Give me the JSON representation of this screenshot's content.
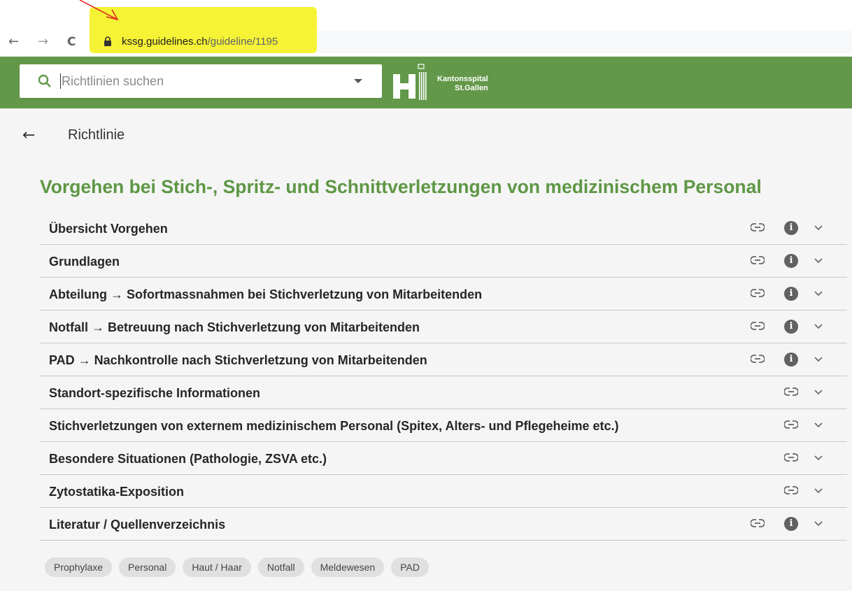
{
  "browser": {
    "back": "←",
    "forward": "→",
    "reload": "C",
    "url_host": "kssg.guidelines.ch",
    "url_path": "/guideline/1195"
  },
  "header": {
    "search_placeholder": "Richtlinien suchen",
    "logo_line1": "Kantonsspital",
    "logo_line2": "St.Gallen",
    "brand_color": "#63984a"
  },
  "page": {
    "back": "←",
    "title": "Richtlinie",
    "guideline_title": "Vorgehen bei Stich-, Spritz- und Schnittverletzungen von medizinischem Personal"
  },
  "sections": [
    {
      "label": "Übersicht Vorgehen",
      "has_info": true
    },
    {
      "label": "Grundlagen",
      "has_info": true
    },
    {
      "label": "Abteilung → Sofortmassnahmen bei Stichverletzung von Mitarbeitenden",
      "has_info": true
    },
    {
      "label": "Notfall → Betreuung nach Stichverletzung von Mitarbeitenden",
      "has_info": true
    },
    {
      "label": "PAD → Nachkontrolle nach Stichverletzung von Mitarbeitenden",
      "has_info": true
    },
    {
      "label": "Standort-spezifische Informationen",
      "has_info": false
    },
    {
      "label": "Stichverletzungen von externem medizinischem Personal (Spitex, Alters- und Pflegeheime etc.)",
      "has_info": false
    },
    {
      "label": "Besondere Situationen (Pathologie, ZSVA etc.)",
      "has_info": false
    },
    {
      "label": "Zytostatika-Exposition",
      "has_info": false
    },
    {
      "label": "Literatur / Quellenverzeichnis",
      "has_info": true
    }
  ],
  "tags": [
    "Prophylaxe",
    "Personal",
    "Haut / Haar",
    "Notfall",
    "Meldewesen",
    "PAD"
  ],
  "icons": {
    "link": "link-icon",
    "info": "info-icon",
    "expand": "chevron-down-icon"
  }
}
